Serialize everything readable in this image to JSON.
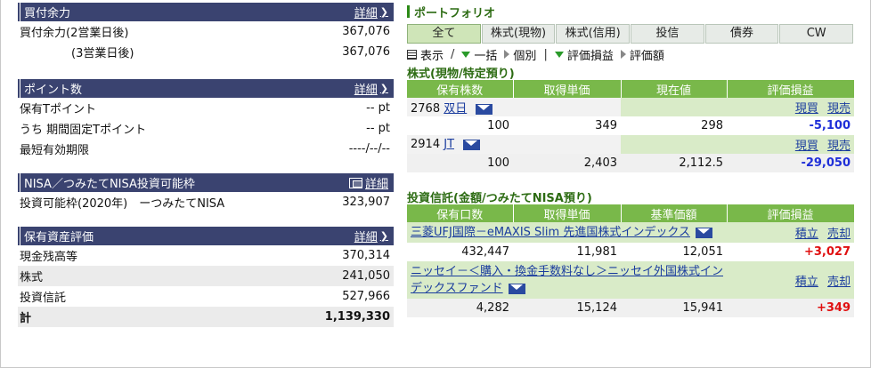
{
  "buying_power": {
    "title": "買付余力",
    "detail": "詳細",
    "rows": [
      {
        "label": "買付余力(2営業日後)",
        "value": "367,076"
      },
      {
        "label": "(3営業日後)",
        "value": "367,076"
      }
    ]
  },
  "points": {
    "title": "ポイント数",
    "detail": "詳細",
    "rows": [
      {
        "label": "保有Tポイント",
        "value": "-- pt"
      },
      {
        "label": "うち 期間固定Tポイント",
        "value": "-- pt"
      },
      {
        "label": "最短有効期限",
        "value": "----/--/--"
      }
    ]
  },
  "nisa": {
    "title": "NISA／つみたてNISA投資可能枠",
    "detail": "詳細",
    "rows": [
      {
        "label": "投資可能枠(2020年)　ーつみたてNISA",
        "value": "323,907"
      }
    ]
  },
  "assets": {
    "title": "保有資産評価",
    "detail": "詳細",
    "rows": [
      {
        "label": "現金残高等",
        "value": "370,314"
      },
      {
        "label": "株式",
        "value": "241,050"
      },
      {
        "label": "投資信託",
        "value": "527,966"
      }
    ],
    "total_label": "計",
    "total_value": "1,139,330"
  },
  "portfolio": {
    "title": "ポートフォリオ",
    "tabs": [
      "全て",
      "株式(現物)",
      "株式(信用)",
      "投信",
      "債券",
      "CW"
    ],
    "active_tab": "全て",
    "filters": {
      "display": "表示",
      "bulk": "一括",
      "individual": "個別",
      "pl": "評価損益",
      "plamount": "評価額",
      "slash": "/",
      "bar": "|"
    },
    "stocks": {
      "section_title": "株式(現物/特定預り)",
      "headers": [
        "保有株数",
        "取得単価",
        "現在値",
        "評価損益"
      ],
      "items": [
        {
          "code": "2768",
          "name": "双日",
          "qty": "100",
          "cost": "349",
          "price": "298",
          "pl": "-5,100",
          "act1": "現買",
          "act2": "現売"
        },
        {
          "code": "2914",
          "name": "JT",
          "qty": "100",
          "cost": "2,403",
          "price": "2,112.5",
          "pl": "-29,050",
          "act1": "現買",
          "act2": "現売"
        }
      ]
    },
    "funds": {
      "section_title": "投資信託(金額/つみたてNISA預り)",
      "headers": [
        "保有口数",
        "取得単価",
        "基準価額",
        "評価損益"
      ],
      "items": [
        {
          "name": "三菱UFJ国際－eMAXIS Slim 先進国株式インデックス",
          "units": "432,447",
          "cost": "11,981",
          "nav": "12,051",
          "pl": "+3,027",
          "act1": "積立",
          "act2": "売却"
        },
        {
          "name": "ニッセイ－＜購入・換金手数料なし＞ニッセイ外国株式インデックスファンド",
          "units": "4,282",
          "cost": "15,124",
          "nav": "15,941",
          "pl": "+349",
          "act1": "積立",
          "act2": "売却"
        }
      ]
    }
  },
  "colors": {
    "left_header": "#3a4370",
    "green_header": "#79b84a",
    "negative": "#1f2fd8",
    "positive": "#e01010"
  }
}
